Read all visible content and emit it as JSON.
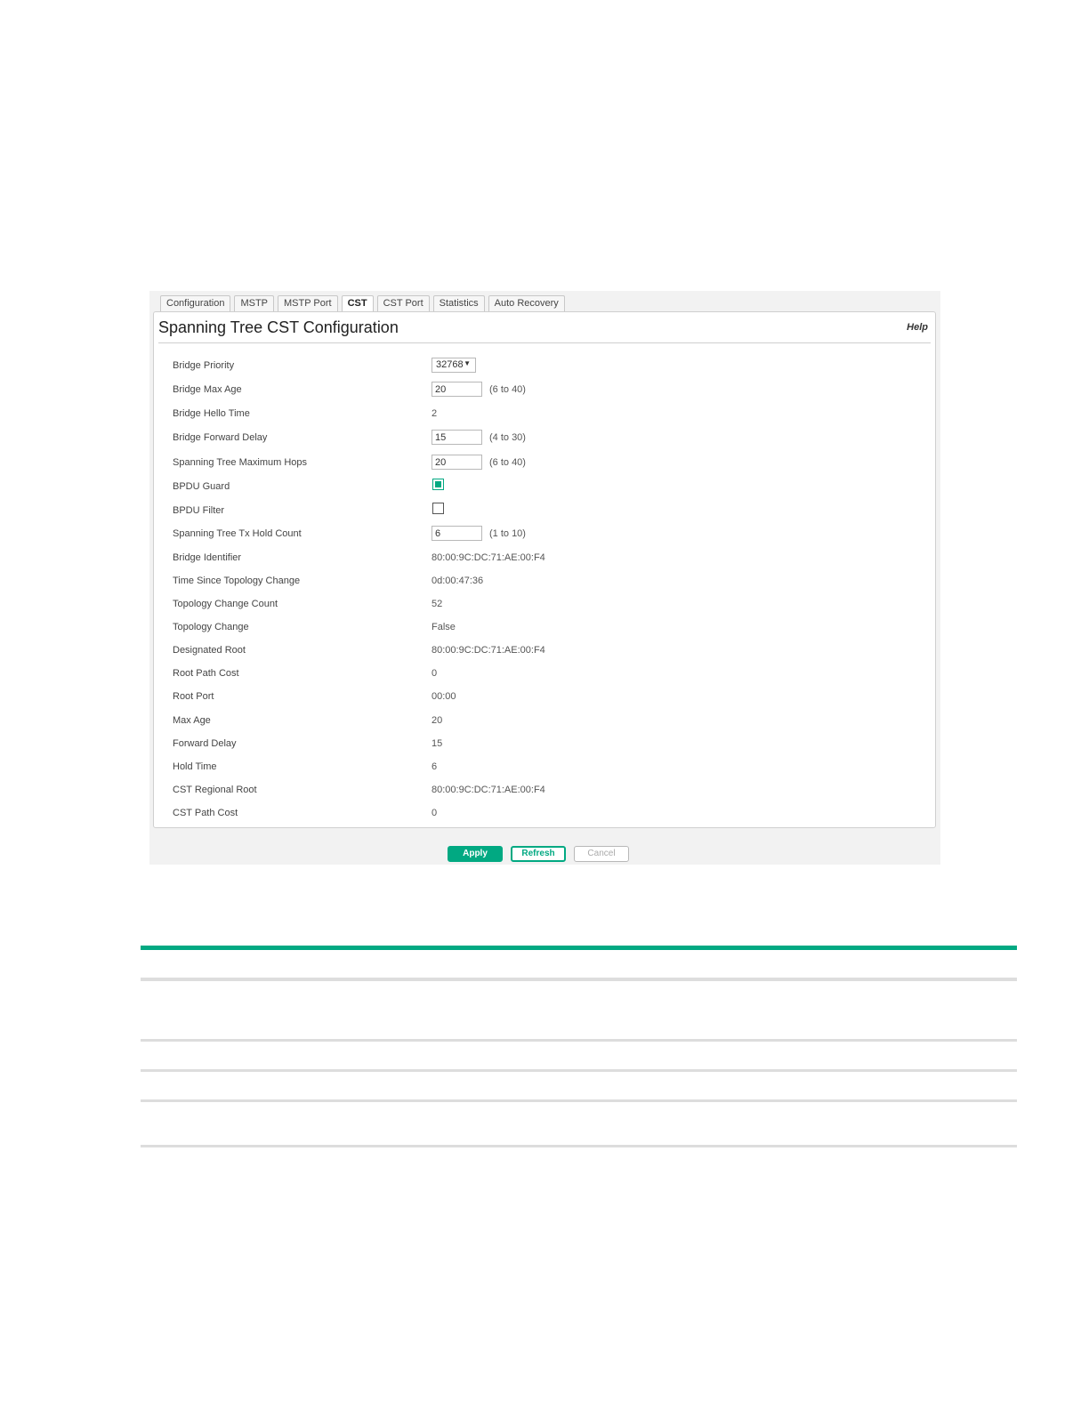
{
  "tabs": [
    "Configuration",
    "MSTP",
    "MSTP Port",
    "CST",
    "CST Port",
    "Statistics",
    "Auto Recovery"
  ],
  "active_tab": "CST",
  "panel": {
    "title": "Spanning Tree CST Configuration",
    "help": "Help"
  },
  "fields": {
    "bridge_priority": {
      "label": "Bridge Priority",
      "value": "32768"
    },
    "bridge_max_age": {
      "label": "Bridge Max Age",
      "value": "20",
      "range": "(6 to 40)"
    },
    "bridge_hello_time": {
      "label": "Bridge Hello Time",
      "value": "2"
    },
    "bridge_forward_delay": {
      "label": "Bridge Forward Delay",
      "value": "15",
      "range": "(4 to 30)"
    },
    "max_hops": {
      "label": "Spanning Tree Maximum Hops",
      "value": "20",
      "range": "(6 to 40)"
    },
    "bpdu_guard": {
      "label": "BPDU Guard",
      "checked": true
    },
    "bpdu_filter": {
      "label": "BPDU Filter",
      "checked": false
    },
    "tx_hold_count": {
      "label": "Spanning Tree Tx Hold Count",
      "value": "6",
      "range": "(1 to 10)"
    },
    "bridge_identifier": {
      "label": "Bridge Identifier",
      "value": "80:00:9C:DC:71:AE:00:F4"
    },
    "time_since_topology_change": {
      "label": "Time Since Topology Change",
      "value": "0d:00:47:36"
    },
    "topology_change_count": {
      "label": "Topology Change Count",
      "value": "52"
    },
    "topology_change": {
      "label": "Topology Change",
      "value": "False"
    },
    "designated_root": {
      "label": "Designated Root",
      "value": "80:00:9C:DC:71:AE:00:F4"
    },
    "root_path_cost": {
      "label": "Root Path Cost",
      "value": "0"
    },
    "root_port": {
      "label": "Root Port",
      "value": "00:00"
    },
    "max_age": {
      "label": "Max Age",
      "value": "20"
    },
    "forward_delay": {
      "label": "Forward Delay",
      "value": "15"
    },
    "hold_time": {
      "label": "Hold Time",
      "value": "6"
    },
    "cst_regional_root": {
      "label": "CST Regional Root",
      "value": "80:00:9C:DC:71:AE:00:F4"
    },
    "cst_path_cost": {
      "label": "CST Path Cost",
      "value": "0"
    }
  },
  "buttons": {
    "apply": "Apply",
    "refresh": "Refresh",
    "cancel": "Cancel"
  },
  "colors": {
    "accent": "#01a982",
    "divider": "#dddddd"
  },
  "icons": {
    "select_arrow": "chevron-down-icon"
  }
}
